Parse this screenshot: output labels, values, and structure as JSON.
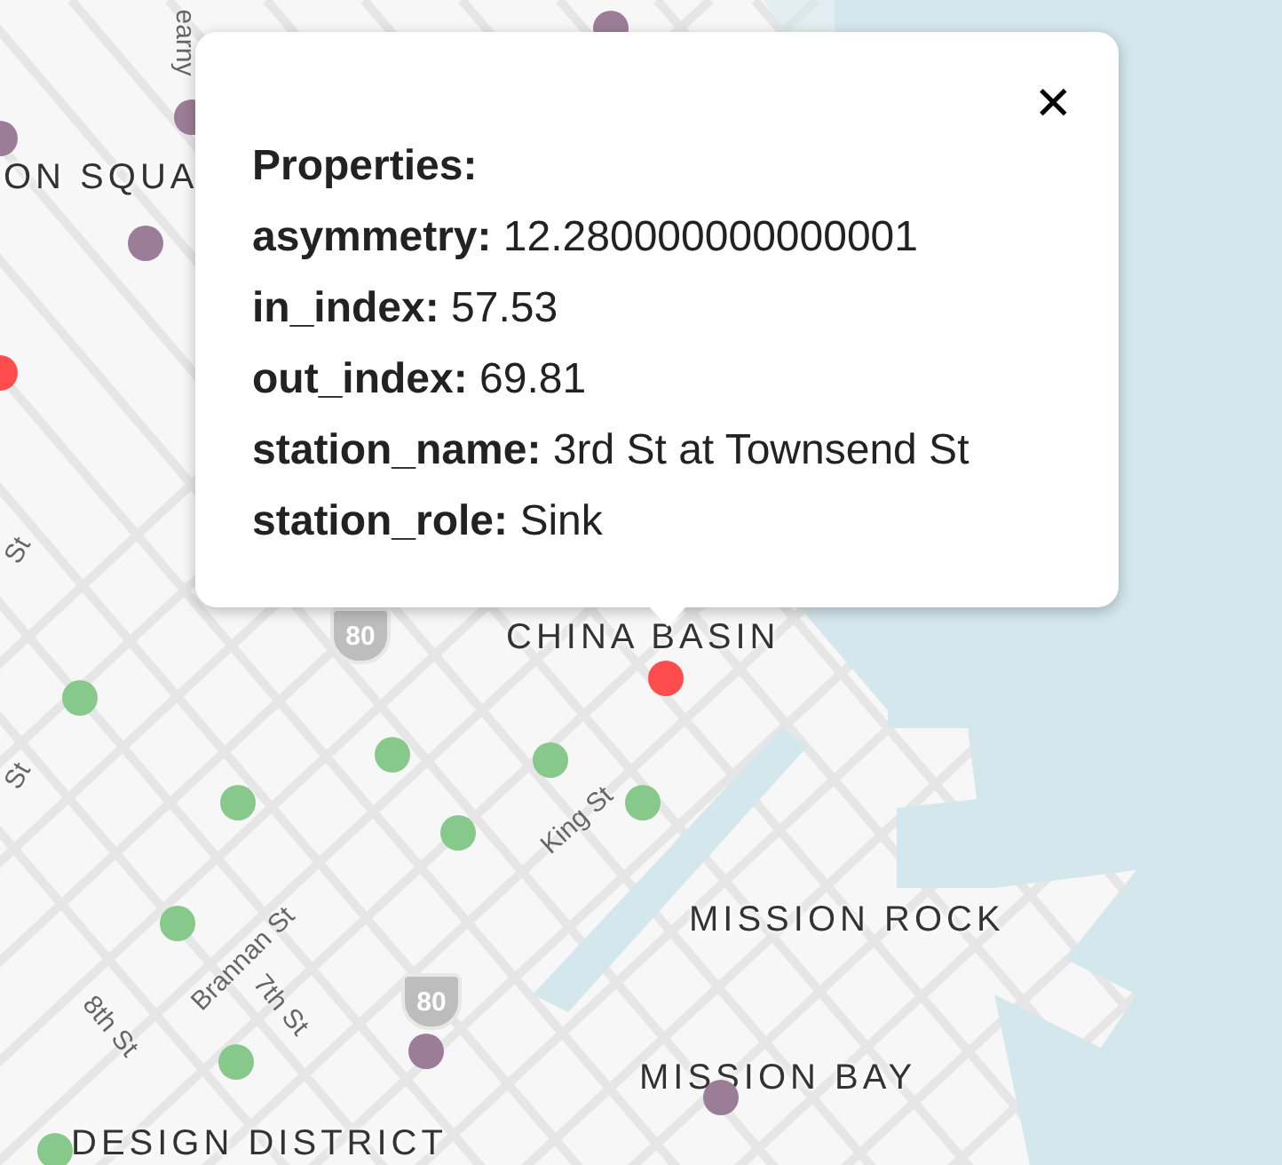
{
  "map": {
    "place_labels": [
      "ON SQUA",
      "CHINA BASIN",
      "MISSION ROCK",
      "MISSION BAY",
      "DESIGN DISTRICT"
    ],
    "street_labels": [
      "earny",
      "St",
      "St",
      "King St",
      "Brannan St",
      "7th St",
      "8th St"
    ],
    "highway_shields": [
      "80",
      "80"
    ],
    "stations": [
      {
        "color": "#9c7d97"
      },
      {
        "color": "#9c7d97"
      },
      {
        "color": "#9c7d97"
      },
      {
        "color": "#9c7d97"
      },
      {
        "color": "#9c7d97"
      },
      {
        "color": "#9c7d97"
      },
      {
        "color": "#ff4d4d"
      },
      {
        "color": "#ff4d4d"
      },
      {
        "color": "#86c98a"
      },
      {
        "color": "#86c98a"
      },
      {
        "color": "#86c98a"
      },
      {
        "color": "#86c98a"
      },
      {
        "color": "#86c98a"
      },
      {
        "color": "#86c98a"
      },
      {
        "color": "#86c98a"
      },
      {
        "color": "#86c98a"
      },
      {
        "color": "#86c98a"
      }
    ]
  },
  "popup": {
    "heading": "Properties:",
    "close": "✕",
    "lines": [
      "**asymmetry:** 12.280000000000001",
      "**in_index:** 57.53",
      "**out_index:** 69.81",
      "**station_name:** 3rd St at Townsend St",
      "**station_role:** Sink"
    ]
  }
}
